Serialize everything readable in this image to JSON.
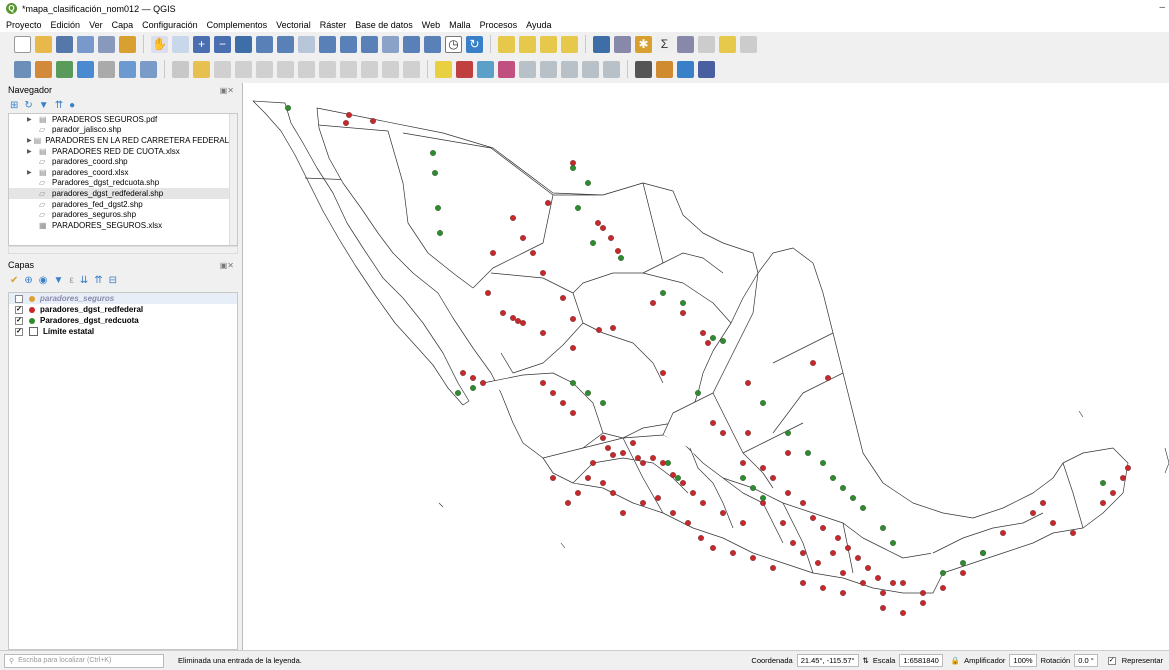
{
  "window": {
    "title": "*mapa_clasificación_nom012 — QGIS",
    "app_icon": "qgis-logo-icon"
  },
  "menu": [
    "Proyecto",
    "Edición",
    "Ver",
    "Capa",
    "Configuración",
    "Complementos",
    "Vectorial",
    "Ráster",
    "Base de datos",
    "Web",
    "Malla",
    "Procesos",
    "Ayuda"
  ],
  "navigator": {
    "title": "Navegador",
    "items": [
      {
        "label": "PARADEROS SEGUROS.pdf",
        "icon": "file-icon",
        "expandable": true
      },
      {
        "label": "parador_jalisco.shp",
        "icon": "vector-icon",
        "expandable": false
      },
      {
        "label": "PARADORES EN LA RED CARRETERA FEDERAL LIBRE",
        "icon": "file-icon",
        "expandable": true
      },
      {
        "label": "PARADORES RED DE CUOTA.xlsx",
        "icon": "file-icon",
        "expandable": true
      },
      {
        "label": "paradores_coord.shp",
        "icon": "vector-icon",
        "expandable": false
      },
      {
        "label": "paradores_coord.xlsx",
        "icon": "file-icon",
        "expandable": true
      },
      {
        "label": "Paradores_dgst_redcuota.shp",
        "icon": "vector-icon",
        "expandable": false
      },
      {
        "label": "paradores_dgst_redfederal.shp",
        "icon": "vector-icon",
        "expandable": false,
        "selected": true
      },
      {
        "label": "paradores_fed_dgst2.shp",
        "icon": "vector-icon",
        "expandable": false
      },
      {
        "label": "paradores_seguros.shp",
        "icon": "vector-icon",
        "expandable": false
      },
      {
        "label": "PARADORES_SEGUROS.xlsx",
        "icon": "table-icon",
        "expandable": false
      }
    ]
  },
  "layers": {
    "title": "Capas",
    "items": [
      {
        "label": "paradores_seguros",
        "checked": false,
        "color": "#e0a030",
        "symbol": "point",
        "dim": true
      },
      {
        "label": "paradores_dgst_redfederal",
        "checked": true,
        "color": "#c8282a",
        "symbol": "point",
        "dim": false
      },
      {
        "label": "Paradores_dgst_redcuota",
        "checked": true,
        "color": "#2e8b2e",
        "symbol": "point",
        "dim": false
      },
      {
        "label": "Límite estatal",
        "checked": true,
        "color": "#ffffff",
        "symbol": "polygon",
        "dim": false
      }
    ]
  },
  "status": {
    "locator_placeholder": "Escriba para localizar (Ctrl+K)",
    "message": "Eliminada una entrada de la leyenda.",
    "coord_label": "Coordenada",
    "coord_value": "21.45°, -115.57°",
    "scale_label": "Escala",
    "scale_value": "1:6581840",
    "magnifier_label": "Amplificador",
    "magnifier_value": "100%",
    "rotation_label": "Rotación",
    "rotation_value": "0.0 °",
    "render_label": "Representar",
    "render_checked": true
  },
  "colors": {
    "federal": "#c8282a",
    "cuota": "#2e8b2e"
  }
}
